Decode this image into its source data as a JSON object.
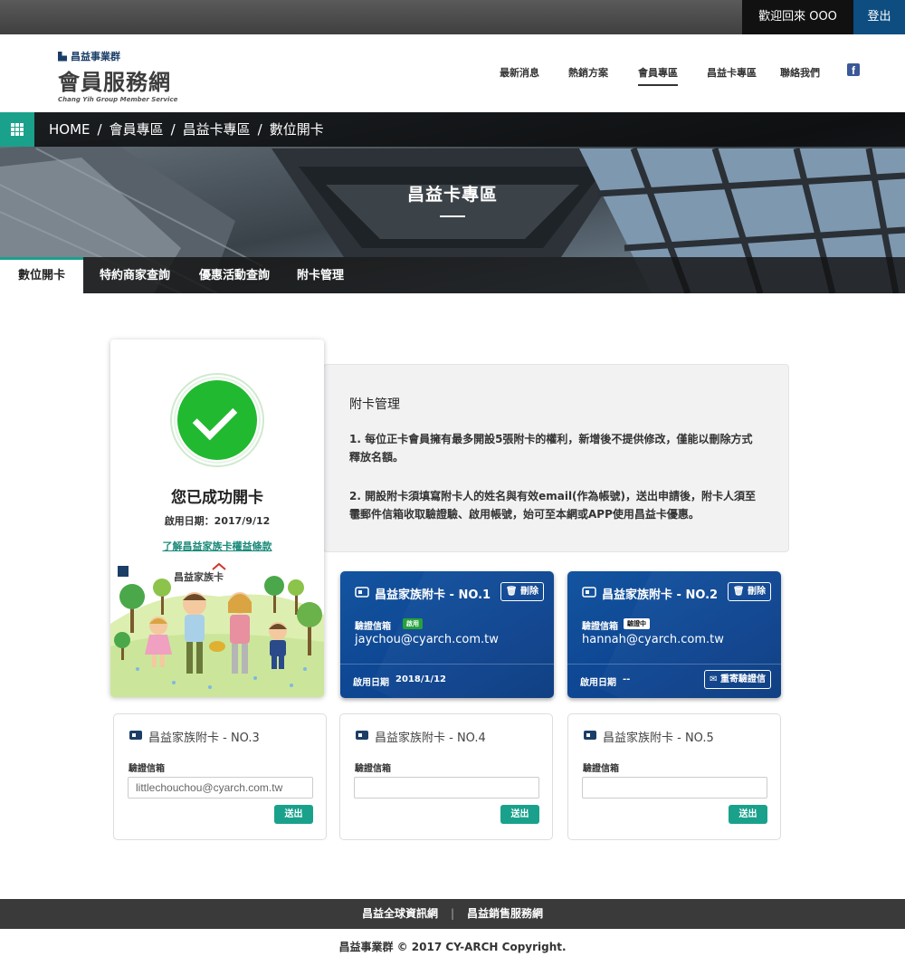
{
  "topbar": {
    "welcome": "歡迎回來 OOO",
    "logout": "登出"
  },
  "logo": {
    "group": "昌益事業群",
    "main": "會員服務網",
    "sub": "Chang Yih Group Member Service"
  },
  "nav": {
    "items": [
      "最新消息",
      "熱銷方案",
      "會員專區",
      "昌益卡專區",
      "聯絡我們"
    ],
    "active": "會員專區",
    "facebook": "f"
  },
  "breadcrumb": {
    "items": [
      "HOME",
      "會員專區",
      "昌益卡專區",
      "數位開卡"
    ],
    "separator": "/"
  },
  "hero": {
    "title": "昌益卡專區"
  },
  "tabs": [
    "數位開卡",
    "特約商家查詢",
    "優惠活動查詢",
    "附卡管理"
  ],
  "success": {
    "heading": "您已成功開卡",
    "date": "啟用日期：2017/9/12",
    "link": "了解昌益家族卡權益條款",
    "illustration_text": "昌益家族卡"
  },
  "info": {
    "title": "附卡管理",
    "para1_line1": "1. 每位正卡會員擁有最多開設5張附卡的權利，新增後不提供修改，僅能以刪除方式",
    "para1_line2": "釋放名額。",
    "para2_line1": "2. 開設附卡須填寫附卡人的姓名與有效email(作為帳號)，送出申請後，附卡人須至電",
    "para2_line2": "子郵件信箱收取驗證驗、啟用帳號，始可至本網或APP使用昌益卡優惠。"
  },
  "cards": [
    {
      "title": "昌益家族附卡 - NO.1",
      "delete": "刪除",
      "label": "驗證信箱",
      "badge": "啟用",
      "email": "jaychou@cyarch.com.tw",
      "since_label": "啟用日期",
      "since": "2018/1/12"
    },
    {
      "title": "昌益家族附卡 - NO.2",
      "delete": "刪除",
      "label": "驗證信箱",
      "badge": "驗證中",
      "email": "hannah@cyarch.com.tw",
      "since_label": "啟用日期",
      "since": "--",
      "resend": "重寄驗證信"
    },
    {
      "title": "昌益家族附卡 - NO.3",
      "label": "驗證信箱",
      "value": "littlechouchou@cyarch.com.tw",
      "send": "送出"
    },
    {
      "title": "昌益家族附卡 - NO.4",
      "label": "驗證信箱",
      "value": "",
      "send": "送出"
    },
    {
      "title": "昌益家族附卡 - NO.5",
      "label": "驗證信箱",
      "value": "",
      "send": "送出"
    }
  ],
  "footer": {
    "links": [
      "昌益全球資訊網",
      "昌益銷售服務網"
    ],
    "separator": "|",
    "copyright": "昌益事業群 © 2017 CY-ARCH Copyright."
  },
  "colors": {
    "accent": "#1aa18c",
    "brand_blue": "#0e4d80",
    "card_blue": "#0d4490",
    "success_green": "#21b930"
  }
}
